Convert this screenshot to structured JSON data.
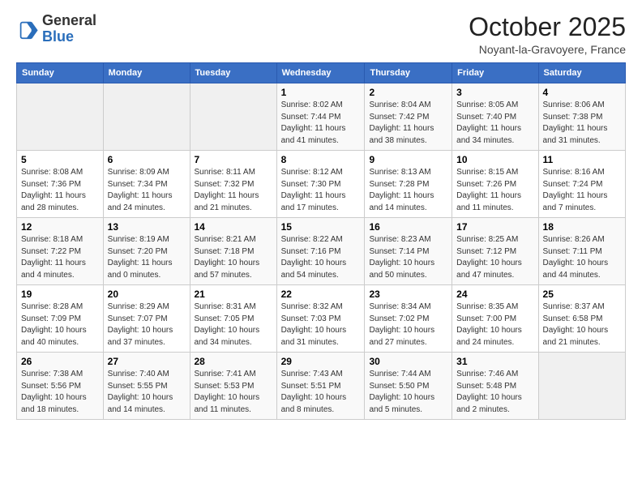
{
  "header": {
    "logo_general": "General",
    "logo_blue": "Blue",
    "month_title": "October 2025",
    "subtitle": "Noyant-la-Gravoyere, France"
  },
  "days_of_week": [
    "Sunday",
    "Monday",
    "Tuesday",
    "Wednesday",
    "Thursday",
    "Friday",
    "Saturday"
  ],
  "weeks": [
    [
      {
        "day": "",
        "info": ""
      },
      {
        "day": "",
        "info": ""
      },
      {
        "day": "",
        "info": ""
      },
      {
        "day": "1",
        "info": "Sunrise: 8:02 AM\nSunset: 7:44 PM\nDaylight: 11 hours\nand 41 minutes."
      },
      {
        "day": "2",
        "info": "Sunrise: 8:04 AM\nSunset: 7:42 PM\nDaylight: 11 hours\nand 38 minutes."
      },
      {
        "day": "3",
        "info": "Sunrise: 8:05 AM\nSunset: 7:40 PM\nDaylight: 11 hours\nand 34 minutes."
      },
      {
        "day": "4",
        "info": "Sunrise: 8:06 AM\nSunset: 7:38 PM\nDaylight: 11 hours\nand 31 minutes."
      }
    ],
    [
      {
        "day": "5",
        "info": "Sunrise: 8:08 AM\nSunset: 7:36 PM\nDaylight: 11 hours\nand 28 minutes."
      },
      {
        "day": "6",
        "info": "Sunrise: 8:09 AM\nSunset: 7:34 PM\nDaylight: 11 hours\nand 24 minutes."
      },
      {
        "day": "7",
        "info": "Sunrise: 8:11 AM\nSunset: 7:32 PM\nDaylight: 11 hours\nand 21 minutes."
      },
      {
        "day": "8",
        "info": "Sunrise: 8:12 AM\nSunset: 7:30 PM\nDaylight: 11 hours\nand 17 minutes."
      },
      {
        "day": "9",
        "info": "Sunrise: 8:13 AM\nSunset: 7:28 PM\nDaylight: 11 hours\nand 14 minutes."
      },
      {
        "day": "10",
        "info": "Sunrise: 8:15 AM\nSunset: 7:26 PM\nDaylight: 11 hours\nand 11 minutes."
      },
      {
        "day": "11",
        "info": "Sunrise: 8:16 AM\nSunset: 7:24 PM\nDaylight: 11 hours\nand 7 minutes."
      }
    ],
    [
      {
        "day": "12",
        "info": "Sunrise: 8:18 AM\nSunset: 7:22 PM\nDaylight: 11 hours\nand 4 minutes."
      },
      {
        "day": "13",
        "info": "Sunrise: 8:19 AM\nSunset: 7:20 PM\nDaylight: 11 hours\nand 0 minutes."
      },
      {
        "day": "14",
        "info": "Sunrise: 8:21 AM\nSunset: 7:18 PM\nDaylight: 10 hours\nand 57 minutes."
      },
      {
        "day": "15",
        "info": "Sunrise: 8:22 AM\nSunset: 7:16 PM\nDaylight: 10 hours\nand 54 minutes."
      },
      {
        "day": "16",
        "info": "Sunrise: 8:23 AM\nSunset: 7:14 PM\nDaylight: 10 hours\nand 50 minutes."
      },
      {
        "day": "17",
        "info": "Sunrise: 8:25 AM\nSunset: 7:12 PM\nDaylight: 10 hours\nand 47 minutes."
      },
      {
        "day": "18",
        "info": "Sunrise: 8:26 AM\nSunset: 7:11 PM\nDaylight: 10 hours\nand 44 minutes."
      }
    ],
    [
      {
        "day": "19",
        "info": "Sunrise: 8:28 AM\nSunset: 7:09 PM\nDaylight: 10 hours\nand 40 minutes."
      },
      {
        "day": "20",
        "info": "Sunrise: 8:29 AM\nSunset: 7:07 PM\nDaylight: 10 hours\nand 37 minutes."
      },
      {
        "day": "21",
        "info": "Sunrise: 8:31 AM\nSunset: 7:05 PM\nDaylight: 10 hours\nand 34 minutes."
      },
      {
        "day": "22",
        "info": "Sunrise: 8:32 AM\nSunset: 7:03 PM\nDaylight: 10 hours\nand 31 minutes."
      },
      {
        "day": "23",
        "info": "Sunrise: 8:34 AM\nSunset: 7:02 PM\nDaylight: 10 hours\nand 27 minutes."
      },
      {
        "day": "24",
        "info": "Sunrise: 8:35 AM\nSunset: 7:00 PM\nDaylight: 10 hours\nand 24 minutes."
      },
      {
        "day": "25",
        "info": "Sunrise: 8:37 AM\nSunset: 6:58 PM\nDaylight: 10 hours\nand 21 minutes."
      }
    ],
    [
      {
        "day": "26",
        "info": "Sunrise: 7:38 AM\nSunset: 5:56 PM\nDaylight: 10 hours\nand 18 minutes."
      },
      {
        "day": "27",
        "info": "Sunrise: 7:40 AM\nSunset: 5:55 PM\nDaylight: 10 hours\nand 14 minutes."
      },
      {
        "day": "28",
        "info": "Sunrise: 7:41 AM\nSunset: 5:53 PM\nDaylight: 10 hours\nand 11 minutes."
      },
      {
        "day": "29",
        "info": "Sunrise: 7:43 AM\nSunset: 5:51 PM\nDaylight: 10 hours\nand 8 minutes."
      },
      {
        "day": "30",
        "info": "Sunrise: 7:44 AM\nSunset: 5:50 PM\nDaylight: 10 hours\nand 5 minutes."
      },
      {
        "day": "31",
        "info": "Sunrise: 7:46 AM\nSunset: 5:48 PM\nDaylight: 10 hours\nand 2 minutes."
      },
      {
        "day": "",
        "info": ""
      }
    ]
  ]
}
